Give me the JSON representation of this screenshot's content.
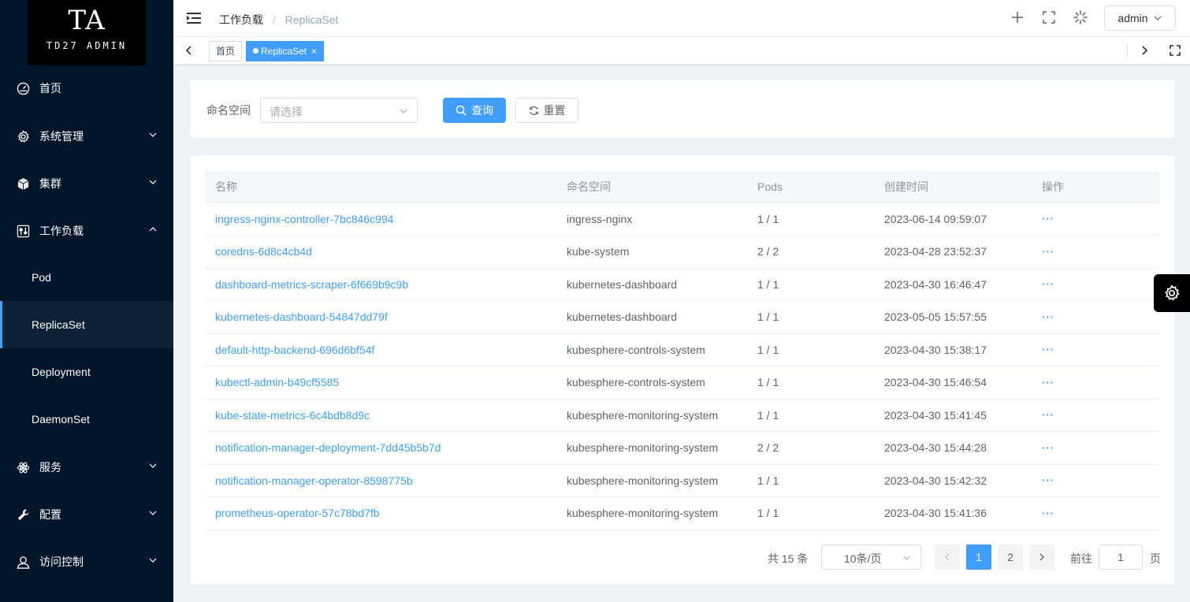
{
  "logo": {
    "big": "TA",
    "small": "TD27 ADMIN"
  },
  "sidebar": {
    "items": [
      {
        "label": "首页",
        "icon": "dashboard-icon"
      },
      {
        "label": "系统管理",
        "icon": "gear-icon"
      },
      {
        "label": "集群",
        "icon": "box-icon"
      },
      {
        "label": "工作负载",
        "icon": "sliders-icon"
      },
      {
        "label": "Pod"
      },
      {
        "label": "ReplicaSet"
      },
      {
        "label": "Deployment"
      },
      {
        "label": "DaemonSet"
      },
      {
        "label": "服务",
        "icon": "atom-icon"
      },
      {
        "label": "配置",
        "icon": "wrench-icon"
      },
      {
        "label": "访问控制",
        "icon": "user-icon"
      }
    ]
  },
  "header": {
    "breadcrumb": [
      "工作负载",
      "ReplicaSet"
    ],
    "breadcrumb_sep": "/",
    "user": "admin"
  },
  "tags": [
    {
      "label": "首页"
    },
    {
      "label": "ReplicaSet",
      "close": "×"
    }
  ],
  "search": {
    "label": "命名空间",
    "placeholder": "请选择",
    "query_label": "查询",
    "reset_label": "重置"
  },
  "table": {
    "columns": [
      "名称",
      "命名空间",
      "Pods",
      "创建时间",
      "操作"
    ],
    "rows": [
      {
        "name": "ingress-nginx-controller-7bc846c994",
        "namespace": "ingress-nginx",
        "pods": "1 / 1",
        "created": "2023-06-14 09:59:07",
        "ops": "···"
      },
      {
        "name": "coredns-6d8c4cb4d",
        "namespace": "kube-system",
        "pods": "2 / 2",
        "created": "2023-04-28 23:52:37",
        "ops": "···"
      },
      {
        "name": "dashboard-metrics-scraper-6f669b9c9b",
        "namespace": "kubernetes-dashboard",
        "pods": "1 / 1",
        "created": "2023-04-30 16:46:47",
        "ops": "···"
      },
      {
        "name": "kubernetes-dashboard-54847dd79f",
        "namespace": "kubernetes-dashboard",
        "pods": "1 / 1",
        "created": "2023-05-05 15:57:55",
        "ops": "···"
      },
      {
        "name": "default-http-backend-696d6bf54f",
        "namespace": "kubesphere-controls-system",
        "pods": "1 / 1",
        "created": "2023-04-30 15:38:17",
        "ops": "···"
      },
      {
        "name": "kubectl-admin-b49cf5585",
        "namespace": "kubesphere-controls-system",
        "pods": "1 / 1",
        "created": "2023-04-30 15:46:54",
        "ops": "···"
      },
      {
        "name": "kube-state-metrics-6c4bdb8d9c",
        "namespace": "kubesphere-monitoring-system",
        "pods": "1 / 1",
        "created": "2023-04-30 15:41:45",
        "ops": "···"
      },
      {
        "name": "notification-manager-deployment-7dd45b5b7d",
        "namespace": "kubesphere-monitoring-system",
        "pods": "2 / 2",
        "created": "2023-04-30 15:44:28",
        "ops": "···"
      },
      {
        "name": "notification-manager-operator-8598775b",
        "namespace": "kubesphere-monitoring-system",
        "pods": "1 / 1",
        "created": "2023-04-30 15:42:32",
        "ops": "···"
      },
      {
        "name": "prometheus-operator-57c78bd7fb",
        "namespace": "kubesphere-monitoring-system",
        "pods": "1 / 1",
        "created": "2023-04-30 15:41:36",
        "ops": "···"
      }
    ]
  },
  "pagination": {
    "total": "共 15 条",
    "page_size": "10条/页",
    "pages": [
      "1",
      "2"
    ],
    "current": "1",
    "goto_label": "前往",
    "goto_value": "1",
    "page_suffix": "页"
  },
  "colors": {
    "primary": "#409eff",
    "sidebar": "#001529"
  }
}
